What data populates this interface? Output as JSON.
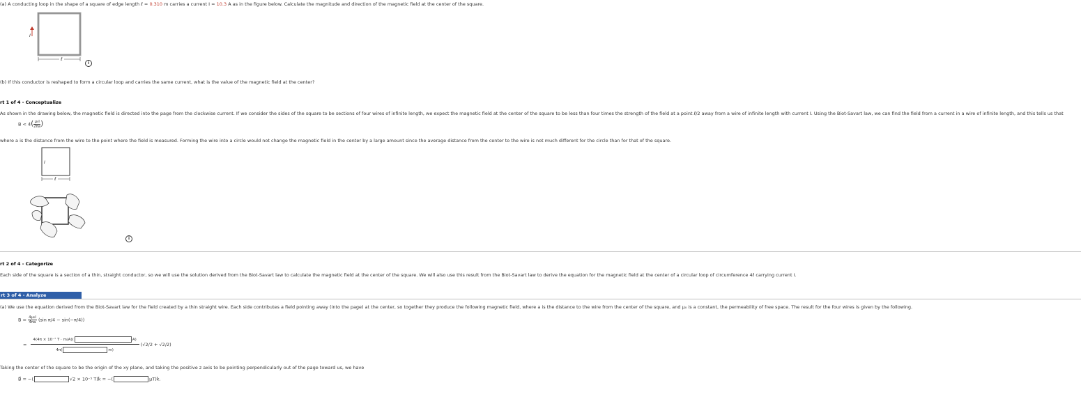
{
  "problem": {
    "a_text_1": "(a) A conducting loop in the shape of a square of edge length ",
    "a_var_l": "ℓ",
    "a_eq": " = ",
    "a_l_value": "0.310",
    "a_text_2": " m carries a current ",
    "a_var_I": "I",
    "a_I_value": "10.3",
    "a_text_3": " A as in the figure below. Calculate the magnitude and direction of the magnetic field at the center of the square.",
    "b_text": "(b) If this conductor is reshaped to form a circular loop and carries the same current, what is the value of the magnetic field at the center?",
    "fig_I_label": "I",
    "fig_l_label": "ℓ"
  },
  "part1": {
    "heading": "rt 1 of 4 - Conceptualize",
    "para": "As shown in the drawing below, the magnetic field is directed into the page from the clockwise current. If we consider the sides of the square to be sections of four wires of infinite length, we expect the magnetic field at the center of the square to be less than four times the strength of the field at a point ℓ/2 away from a wire of infinite length with current I. Using the Biot-Savart law, we can find the field from a current in a wire of infinite length, and this tells us that",
    "eq_lhs": "B < 4",
    "eq_num": "μ₀I",
    "eq_den": "2πa",
    "where": "where a is the distance from the wire to the point where the field is measured. Forming the wire into a circle would not change the magnetic field in the center by a large amount since the average distance from the center to the wire is not much different for the circle than for that of the square.",
    "fig_I": "I",
    "fig_l": "ℓ"
  },
  "part2": {
    "heading": "rt 2 of 4 - Categorize",
    "para": "Each side of the square is a section of a thin, straight conductor, so we will use the solution derived from the Biot-Savart law to calculate the magnetic field at the center of the square. We will also use this result from the Biot-Savart law to derive the equation for the magnetic field at the center of a circular loop of circumference 4ℓ carrying current I."
  },
  "part3": {
    "heading": "rt 3 of 4 - Analyze",
    "para": "(a) We use the equation derived from the Biot-Savart law for the field created by a thin straight wire. Each side contributes a field pointing away (into the page) at the center, so together they produce the following magnetic field, where a is the distance to the wire from the center of the square, and μ₀ is a constant, the permeability of free space. The result for the four wires is given by the following.",
    "eq1_lhs": "B =",
    "eq1_num": "4μ₀I",
    "eq1_den": "4πa",
    "eq1_rest": "(sin π/4 − sin(−π/4))",
    "eq2_eq": "=",
    "eq2_num_pre": "4(4π × 10⁻⁷ T · m/A)(",
    "eq2_num_unit": "A)",
    "eq2_den_pre": "4π(",
    "eq2_den_unit": "m)",
    "eq2_rest": "(√2/2 + √2/2)",
    "taking": "Taking the center of the square to be the origin of the xy plane, and taking the positive z axis to be pointing perpendicularly out of the page toward us, we have",
    "final_lhs": "B⃗ = −(",
    "final_mid": "√2 × 10⁻⁵ T)k̂ = −(",
    "final_end": "μT)k̂."
  },
  "colors": {
    "highlight": "#c0392b",
    "part_bar": "#2f5fa8"
  },
  "icons": [
    "info-icon",
    "current-arrow-icon",
    "hand-icon"
  ]
}
